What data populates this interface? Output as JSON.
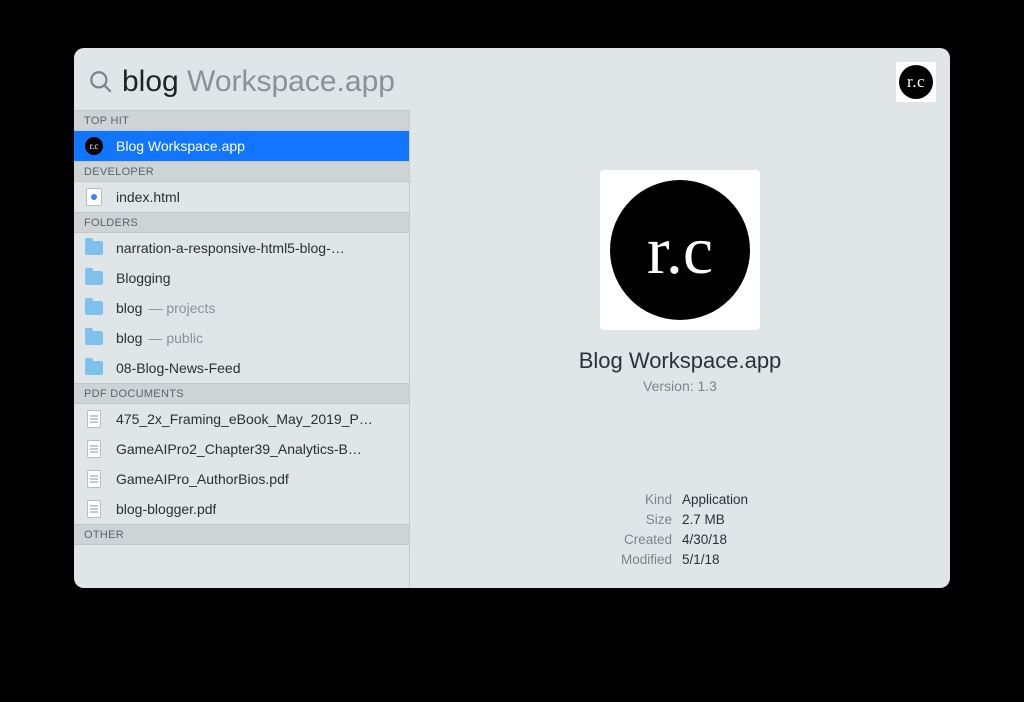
{
  "search": {
    "typed": "blog",
    "completion": " Workspace.app"
  },
  "corner_badge_text": "r.c",
  "sections": [
    {
      "header": "TOP HIT",
      "items": [
        {
          "icon": "app",
          "label": "Blog Workspace.app",
          "suffix": "",
          "selected": true
        }
      ]
    },
    {
      "header": "DEVELOPER",
      "items": [
        {
          "icon": "html",
          "label": "index.html",
          "suffix": ""
        }
      ]
    },
    {
      "header": "FOLDERS",
      "items": [
        {
          "icon": "folder",
          "label": "narration-a-responsive-html5-blog-…",
          "suffix": ""
        },
        {
          "icon": "folder",
          "label": "Blogging",
          "suffix": ""
        },
        {
          "icon": "folder",
          "label": "blog",
          "suffix": "— projects"
        },
        {
          "icon": "folder",
          "label": "blog",
          "suffix": "— public"
        },
        {
          "icon": "folder",
          "label": "08-Blog-News-Feed",
          "suffix": ""
        }
      ]
    },
    {
      "header": "PDF DOCUMENTS",
      "items": [
        {
          "icon": "doc",
          "label": "475_2x_Framing_eBook_May_2019_P…",
          "suffix": ""
        },
        {
          "icon": "doc",
          "label": "GameAIPro2_Chapter39_Analytics-B…",
          "suffix": ""
        },
        {
          "icon": "doc",
          "label": "GameAIPro_AuthorBios.pdf",
          "suffix": ""
        },
        {
          "icon": "doc",
          "label": "blog-blogger.pdf",
          "suffix": ""
        }
      ]
    },
    {
      "header": "OTHER",
      "items": []
    }
  ],
  "preview": {
    "badge_text": "r.c",
    "title": "Blog Workspace.app",
    "version": "Version: 1.3",
    "meta": [
      {
        "k": "Kind",
        "v": "Application"
      },
      {
        "k": "Size",
        "v": "2.7 MB"
      },
      {
        "k": "Created",
        "v": "4/30/18"
      },
      {
        "k": "Modified",
        "v": "5/1/18"
      }
    ]
  }
}
